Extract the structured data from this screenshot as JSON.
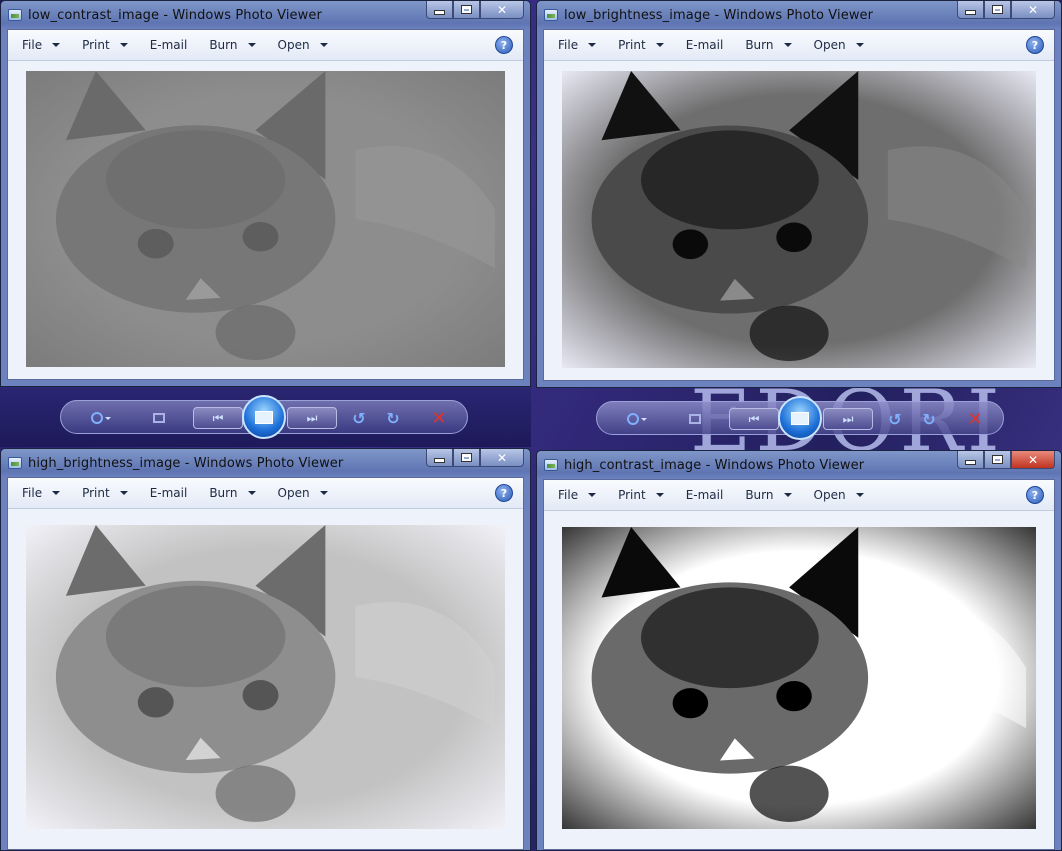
{
  "windows": [
    {
      "title": "low_contrast_image - Windows Photo Viewer",
      "menu": {
        "file": "File",
        "print": "Print",
        "email": "E-mail",
        "burn": "Burn",
        "open": "Open"
      },
      "style": "low-contrast"
    },
    {
      "title": "low_brightness_image - Windows Photo Viewer",
      "menu": {
        "file": "File",
        "print": "Print",
        "email": "E-mail",
        "burn": "Burn",
        "open": "Open"
      },
      "style": "low-brightness"
    },
    {
      "title": "high_brightness_image - Windows Photo Viewer",
      "menu": {
        "file": "File",
        "print": "Print",
        "email": "E-mail",
        "burn": "Burn",
        "open": "Open"
      },
      "style": "high-brightness"
    },
    {
      "title": "high_contrast_image - Windows Photo Viewer",
      "menu": {
        "file": "File",
        "print": "Print",
        "email": "E-mail",
        "burn": "Burn",
        "open": "Open"
      },
      "style": "high-contrast"
    }
  ],
  "help_glyph": "?",
  "icons": {
    "zoom": "zoom-icon",
    "fit": "actual-size-icon",
    "prev": "previous-icon",
    "slideshow": "slideshow-icon",
    "next": "next-icon",
    "rotate_ccw": "rotate-counterclockwise-icon",
    "rotate_cw": "rotate-clockwise-icon",
    "delete": "delete-icon"
  },
  "colors": {
    "close_active": "#c0331f",
    "toolbar": "#3a3a82",
    "accent": "#1d6fd8"
  }
}
